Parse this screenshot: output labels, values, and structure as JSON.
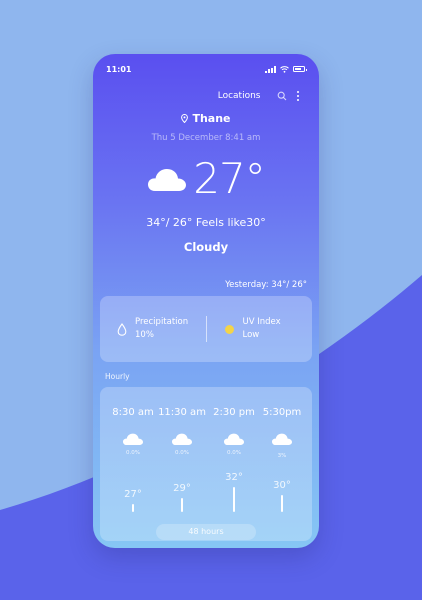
{
  "status_bar": {
    "time": "11:01"
  },
  "header": {
    "locations_label": "Locations"
  },
  "location": {
    "city": "Thane",
    "datetime": "Thu 5 December 8:41 am"
  },
  "current": {
    "temperature": "27°",
    "high_low": "34°/ 26° Feels like30°",
    "condition": "Cloudy",
    "yesterday": "Yesterday: 34°/ 26°",
    "icon": "cloud-icon"
  },
  "details": {
    "precipitation": {
      "label": "Precipitation",
      "value": "10%",
      "icon": "raindrop-icon"
    },
    "uv": {
      "label": "UV Index",
      "value": "Low",
      "icon": "sun-icon"
    }
  },
  "hourly": {
    "label": "Hourly",
    "items": [
      {
        "time": "8:30 am",
        "sub": "0.0%",
        "temp": "27°",
        "icon": "cloud-icon"
      },
      {
        "time": "11:30 am",
        "sub": "0.0%",
        "temp": "29°",
        "icon": "cloud-icon"
      },
      {
        "time": "2:30 pm",
        "sub": "0.0%",
        "temp": "32°",
        "icon": "cloud-icon"
      },
      {
        "time": "5:30pm",
        "sub": "3%",
        "temp": "30°",
        "icon": "cloud-icon"
      }
    ],
    "more_label": "48 hours"
  },
  "colors": {
    "background_light": "#8fb6ee",
    "background_dark": "#5a63ea",
    "phone_top": "#5a4ff0",
    "phone_bottom": "#86c6f4",
    "sun": "#f3d44a"
  }
}
